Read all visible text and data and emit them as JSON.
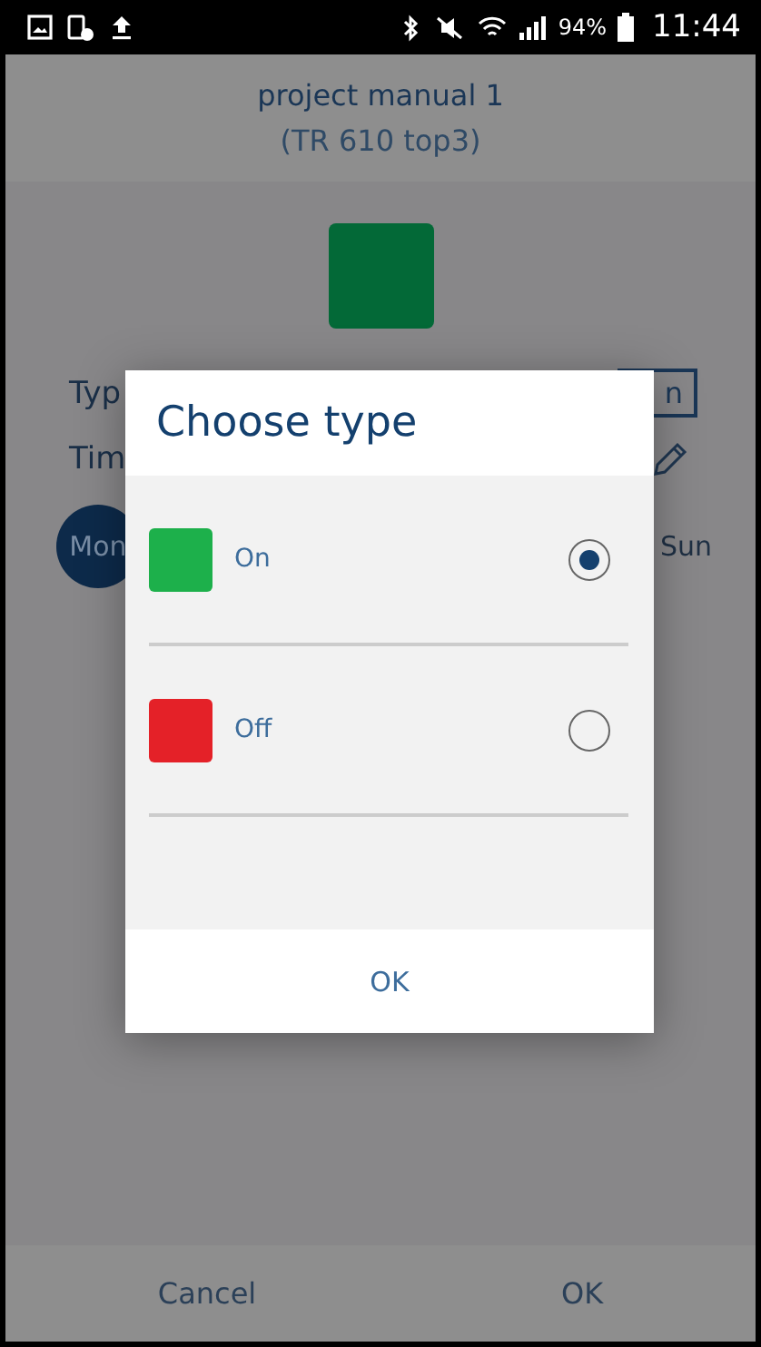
{
  "status_bar": {
    "battery": "94%",
    "time": "11:44"
  },
  "header": {
    "title": "project manual 1",
    "subtitle": "(TR 610 top3)"
  },
  "background": {
    "type_label": "Typ",
    "type_value": "n",
    "time_label": "Tim",
    "days": [
      {
        "label": "Mon",
        "selected": true
      },
      {
        "label": "Sun",
        "selected": false
      }
    ]
  },
  "dialog": {
    "title": "Choose type",
    "options": [
      {
        "label": "On",
        "color": "#1db04b",
        "selected": true
      },
      {
        "label": "Off",
        "color": "#e42128",
        "selected": false
      }
    ],
    "button": "OK"
  },
  "footer": {
    "buttons": [
      "Cancel",
      "OK"
    ]
  }
}
